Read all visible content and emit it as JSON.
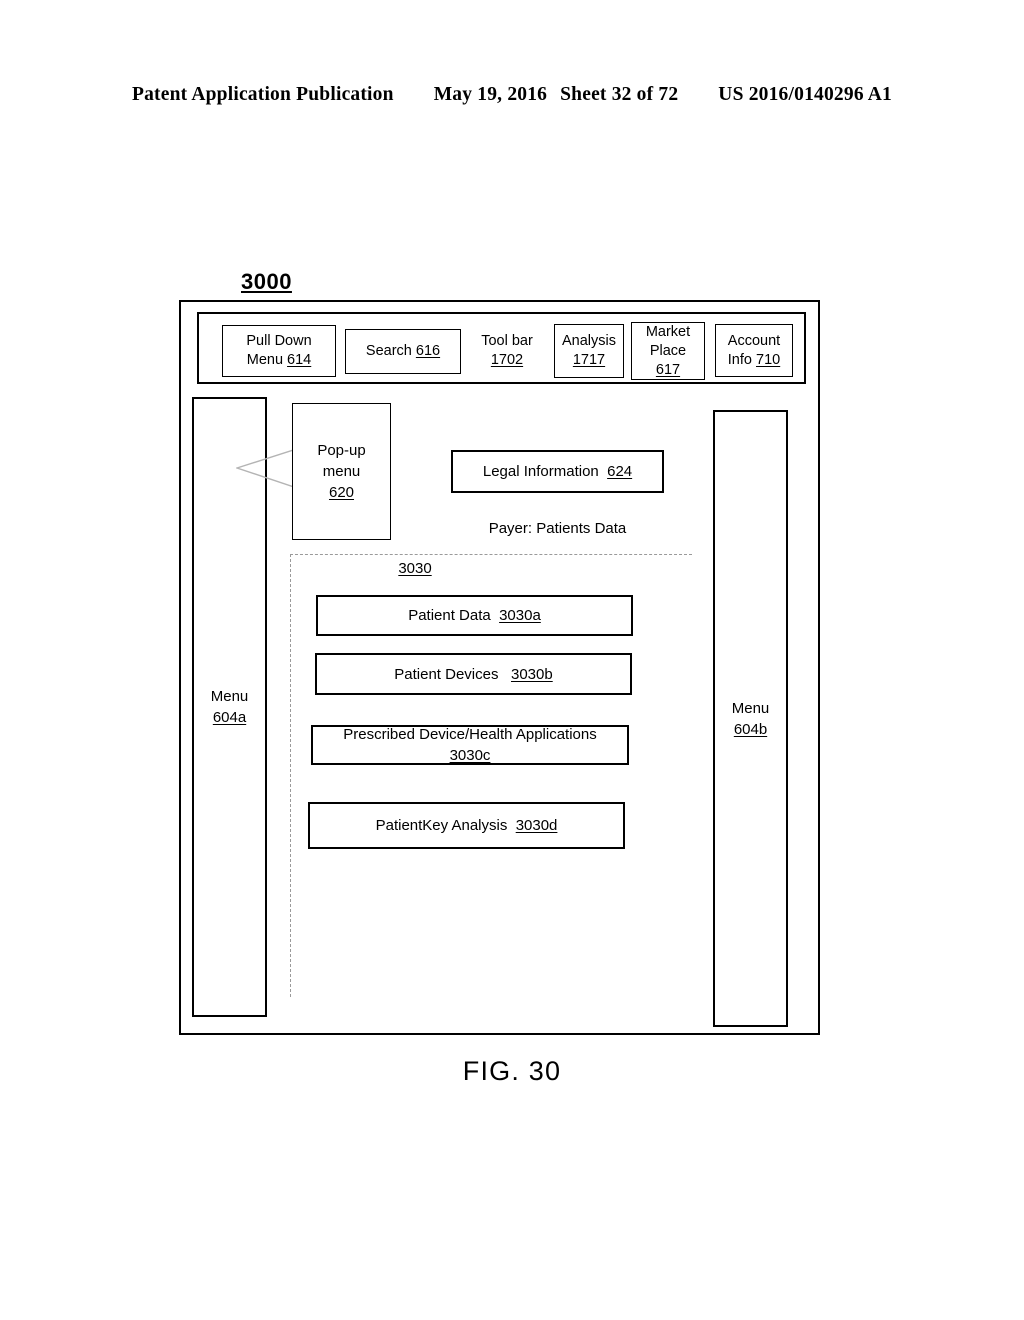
{
  "page_header": {
    "publication": "Patent Application Publication",
    "date": "May 19, 2016",
    "sheet": "Sheet 32 of 72",
    "patent_number": "US 2016/0140296 A1"
  },
  "figure": {
    "reference_tag": "3000",
    "caption": "FIG. 30"
  },
  "toolbar": {
    "label": "Tool bar",
    "label_ref": "1702",
    "items": [
      {
        "label_line1": "Pull Down",
        "label_line2": "Menu",
        "ref": "614"
      },
      {
        "label_line1": "Search",
        "label_line2": "",
        "ref": "616"
      },
      {
        "label_line1": "Analysis",
        "label_line2": "",
        "ref": "1717"
      },
      {
        "label_line1": "Market",
        "label_line2": "Place",
        "ref": "617"
      },
      {
        "label_line1": "Account",
        "label_line2": "Info",
        "ref": "710"
      }
    ]
  },
  "menus": {
    "left": {
      "label": "Menu",
      "ref": "604a"
    },
    "right": {
      "label": "Menu",
      "ref": "604b"
    }
  },
  "popup_menu": {
    "label_line1": "Pop-up",
    "label_line2": "menu",
    "ref": "620"
  },
  "legal_info": {
    "label": "Legal Information",
    "ref": "624"
  },
  "payer_caption": "Payer: Patients Data",
  "content_region": {
    "ref": "3030",
    "boxes": [
      {
        "label": "Patient Data",
        "ref": "3030a"
      },
      {
        "label": "Patient Devices",
        "ref": "3030b"
      },
      {
        "label": "Prescribed Device/Health Applications",
        "ref": "3030c"
      },
      {
        "label": "PatientKey Analysis",
        "ref": "3030d"
      }
    ]
  }
}
